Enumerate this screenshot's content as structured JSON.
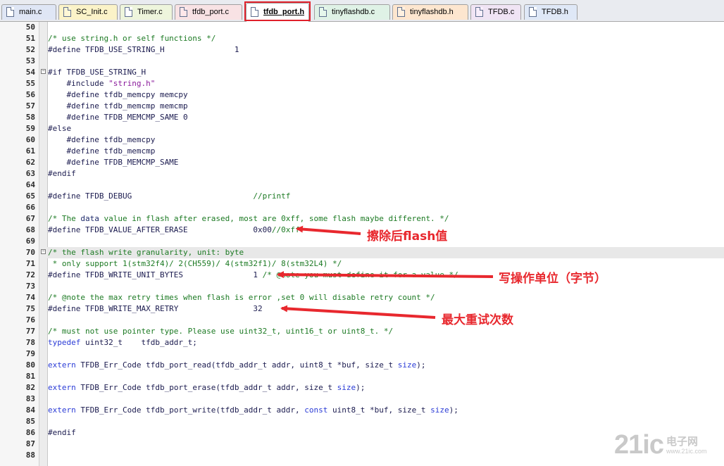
{
  "tabs": [
    {
      "label": "main.c",
      "type": "c"
    },
    {
      "label": "SC_Init.c",
      "type": "c"
    },
    {
      "label": "Timer.c",
      "type": "c"
    },
    {
      "label": "tfdb_port.c",
      "type": "c"
    },
    {
      "label": "tfdb_port.h",
      "type": "h",
      "active": true
    },
    {
      "label": "tinyflashdb.c",
      "type": "c"
    },
    {
      "label": "tinyflashdb.h",
      "type": "h"
    },
    {
      "label": "TFDB.c",
      "type": "c"
    },
    {
      "label": "TFDB.h",
      "type": "h"
    }
  ],
  "code_lines": [
    {
      "n": "50",
      "t": ""
    },
    {
      "n": "51",
      "t": "/* use string.h or self functions */"
    },
    {
      "n": "52",
      "t": "#define TFDB_USE_STRING_H               1"
    },
    {
      "n": "53",
      "t": ""
    },
    {
      "n": "54",
      "t": "#if TFDB_USE_STRING_H"
    },
    {
      "n": "55",
      "t": "    #include \"string.h\""
    },
    {
      "n": "56",
      "t": "    #define tfdb_memcpy memcpy"
    },
    {
      "n": "57",
      "t": "    #define tfdb_memcmp memcmp"
    },
    {
      "n": "58",
      "t": "    #define TFDB_MEMCMP_SAME 0"
    },
    {
      "n": "59",
      "t": "#else"
    },
    {
      "n": "60",
      "t": "    #define tfdb_memcpy"
    },
    {
      "n": "61",
      "t": "    #define tfdb_memcmp"
    },
    {
      "n": "62",
      "t": "    #define TFDB_MEMCMP_SAME"
    },
    {
      "n": "63",
      "t": "#endif"
    },
    {
      "n": "64",
      "t": ""
    },
    {
      "n": "65",
      "t": "#define TFDB_DEBUG                          //printf"
    },
    {
      "n": "66",
      "t": ""
    },
    {
      "n": "67",
      "t": "/* The data value in flash after erased, most are 0xff, some flash maybe different. */"
    },
    {
      "n": "68",
      "t": "#define TFDB_VALUE_AFTER_ERASE              0x00//0xff"
    },
    {
      "n": "69",
      "t": ""
    },
    {
      "n": "70",
      "t": "/* the flash write granularity, unit: byte"
    },
    {
      "n": "71",
      "t": " * only support 1(stm32f4)/ 2(CH559)/ 4(stm32f1)/ 8(stm32L4) */"
    },
    {
      "n": "72",
      "t": "#define TFDB_WRITE_UNIT_BYTES               1 /* @note you must define it for a value */"
    },
    {
      "n": "73",
      "t": ""
    },
    {
      "n": "74",
      "t": "/* @note the max retry times when flash is error ,set 0 will disable retry count */"
    },
    {
      "n": "75",
      "t": "#define TFDB_WRITE_MAX_RETRY                32"
    },
    {
      "n": "76",
      "t": ""
    },
    {
      "n": "77",
      "t": "/* must not use pointer type. Please use uint32_t, uint16_t or uint8_t. */"
    },
    {
      "n": "78",
      "t": "typedef uint32_t    tfdb_addr_t;"
    },
    {
      "n": "79",
      "t": ""
    },
    {
      "n": "80",
      "t": "extern TFDB_Err_Code tfdb_port_read(tfdb_addr_t addr, uint8_t *buf, size_t size);"
    },
    {
      "n": "81",
      "t": ""
    },
    {
      "n": "82",
      "t": "extern TFDB_Err_Code tfdb_port_erase(tfdb_addr_t addr, size_t size);"
    },
    {
      "n": "83",
      "t": ""
    },
    {
      "n": "84",
      "t": "extern TFDB_Err_Code tfdb_port_write(tfdb_addr_t addr, const uint8_t *buf, size_t size);"
    },
    {
      "n": "85",
      "t": ""
    },
    {
      "n": "86",
      "t": "#endif"
    },
    {
      "n": "87",
      "t": ""
    },
    {
      "n": "88",
      "t": ""
    }
  ],
  "annotations": {
    "erase_value": "擦除后flash值",
    "write_unit": "写操作单位（字节）",
    "max_retry": "最大重试次数"
  },
  "watermark": {
    "brand": "21ic",
    "cn": "电子网",
    "url": "www.21ic.com"
  },
  "colors": {
    "annotation": "#e8282e",
    "comment": "#1c7a23",
    "keyword": "#2a3bd6",
    "string": "#8a1a9b",
    "highlight_line": "#e8e8e8"
  },
  "icons": {
    "c_file": "c-file-icon",
    "h_file": "h-file-icon"
  }
}
